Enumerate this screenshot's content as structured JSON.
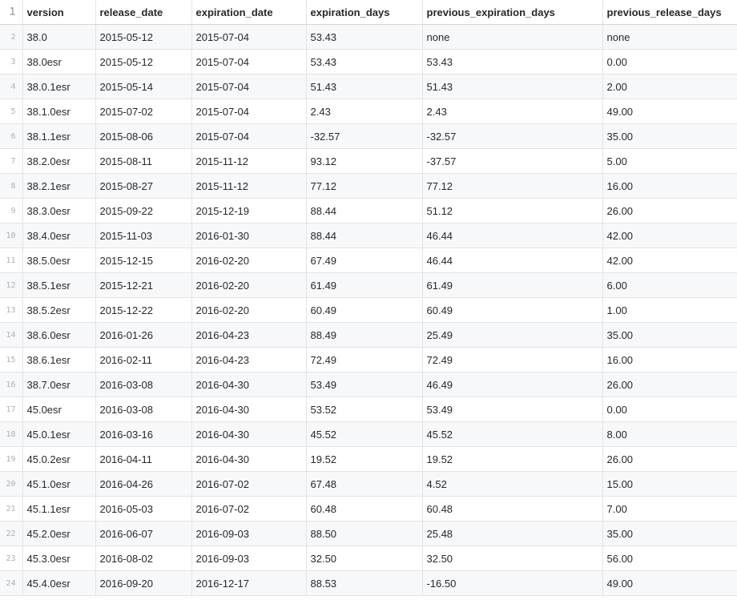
{
  "columns": [
    "version",
    "release_date",
    "expiration_date",
    "expiration_days",
    "previous_expiration_days",
    "previous_release_days"
  ],
  "header_line_number": "1",
  "rows": [
    {
      "line": "2",
      "cells": [
        "38.0",
        "2015-05-12",
        "2015-07-04",
        "53.43",
        "none",
        "none"
      ]
    },
    {
      "line": "3",
      "cells": [
        "38.0esr",
        "2015-05-12",
        "2015-07-04",
        "53.43",
        "53.43",
        "0.00"
      ]
    },
    {
      "line": "4",
      "cells": [
        "38.0.1esr",
        "2015-05-14",
        "2015-07-04",
        "51.43",
        "51.43",
        "2.00"
      ]
    },
    {
      "line": "5",
      "cells": [
        "38.1.0esr",
        "2015-07-02",
        "2015-07-04",
        "2.43",
        "2.43",
        "49.00"
      ]
    },
    {
      "line": "6",
      "cells": [
        "38.1.1esr",
        "2015-08-06",
        "2015-07-04",
        "-32.57",
        "-32.57",
        "35.00"
      ]
    },
    {
      "line": "7",
      "cells": [
        "38.2.0esr",
        "2015-08-11",
        "2015-11-12",
        "93.12",
        "-37.57",
        "5.00"
      ]
    },
    {
      "line": "8",
      "cells": [
        "38.2.1esr",
        "2015-08-27",
        "2015-11-12",
        "77.12",
        "77.12",
        "16.00"
      ]
    },
    {
      "line": "9",
      "cells": [
        "38.3.0esr",
        "2015-09-22",
        "2015-12-19",
        "88.44",
        "51.12",
        "26.00"
      ]
    },
    {
      "line": "10",
      "cells": [
        "38.4.0esr",
        "2015-11-03",
        "2016-01-30",
        "88.44",
        "46.44",
        "42.00"
      ]
    },
    {
      "line": "11",
      "cells": [
        "38.5.0esr",
        "2015-12-15",
        "2016-02-20",
        "67.49",
        "46.44",
        "42.00"
      ]
    },
    {
      "line": "12",
      "cells": [
        "38.5.1esr",
        "2015-12-21",
        "2016-02-20",
        "61.49",
        "61.49",
        "6.00"
      ]
    },
    {
      "line": "13",
      "cells": [
        "38.5.2esr",
        "2015-12-22",
        "2016-02-20",
        "60.49",
        "60.49",
        "1.00"
      ]
    },
    {
      "line": "14",
      "cells": [
        "38.6.0esr",
        "2016-01-26",
        "2016-04-23",
        "88.49",
        "25.49",
        "35.00"
      ]
    },
    {
      "line": "15",
      "cells": [
        "38.6.1esr",
        "2016-02-11",
        "2016-04-23",
        "72.49",
        "72.49",
        "16.00"
      ]
    },
    {
      "line": "16",
      "cells": [
        "38.7.0esr",
        "2016-03-08",
        "2016-04-30",
        "53.49",
        "46.49",
        "26.00"
      ]
    },
    {
      "line": "17",
      "cells": [
        "45.0esr",
        "2016-03-08",
        "2016-04-30",
        "53.52",
        "53.49",
        "0.00"
      ]
    },
    {
      "line": "18",
      "cells": [
        "45.0.1esr",
        "2016-03-16",
        "2016-04-30",
        "45.52",
        "45.52",
        "8.00"
      ]
    },
    {
      "line": "19",
      "cells": [
        "45.0.2esr",
        "2016-04-11",
        "2016-04-30",
        "19.52",
        "19.52",
        "26.00"
      ]
    },
    {
      "line": "20",
      "cells": [
        "45.1.0esr",
        "2016-04-26",
        "2016-07-02",
        "67.48",
        "4.52",
        "15.00"
      ]
    },
    {
      "line": "21",
      "cells": [
        "45.1.1esr",
        "2016-05-03",
        "2016-07-02",
        "60.48",
        "60.48",
        "7.00"
      ]
    },
    {
      "line": "22",
      "cells": [
        "45.2.0esr",
        "2016-06-07",
        "2016-09-03",
        "88.50",
        "25.48",
        "35.00"
      ]
    },
    {
      "line": "23",
      "cells": [
        "45.3.0esr",
        "2016-08-02",
        "2016-09-03",
        "32.50",
        "32.50",
        "56.00"
      ]
    },
    {
      "line": "24",
      "cells": [
        "45.4.0esr",
        "2016-09-20",
        "2016-12-17",
        "88.53",
        "-16.50",
        "49.00"
      ]
    }
  ]
}
